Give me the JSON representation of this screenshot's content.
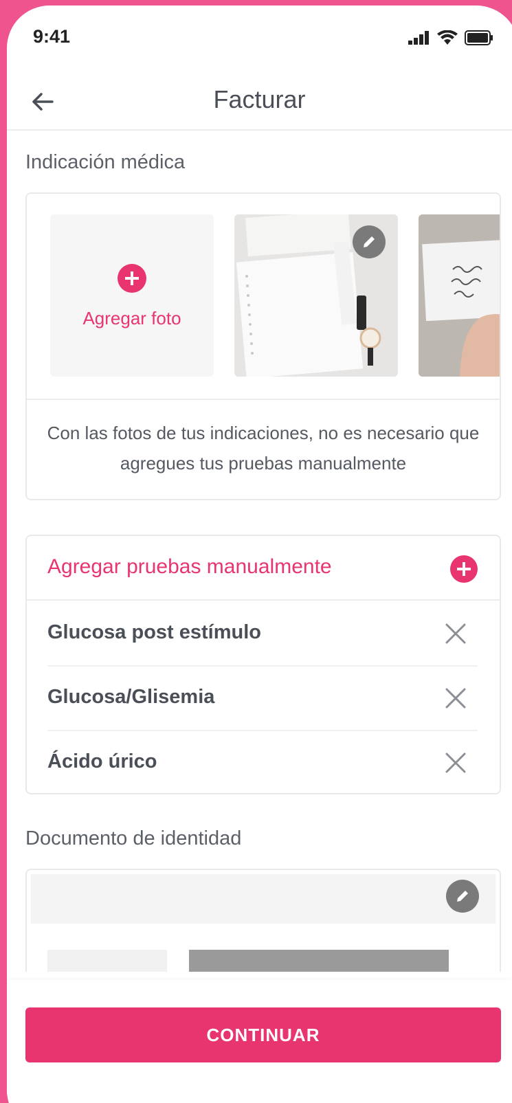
{
  "status_bar": {
    "time": "9:41",
    "icons": [
      "signal-icon",
      "wifi-icon",
      "battery-icon"
    ]
  },
  "header": {
    "back_icon": "arrow-left-icon",
    "title": "Facturar"
  },
  "medical_indication": {
    "label": "Indicación médica",
    "add_photo_label": "Agregar foto",
    "hint": "Con las fotos de tus indicaciones, no es necesario que agregues tus pruebas manualmente"
  },
  "manual_tests": {
    "header_label": "Agregar pruebas manualmente",
    "items": [
      {
        "label": "Glucosa post estímulo"
      },
      {
        "label": "Glucosa/Glisemia"
      },
      {
        "label": "Ácido úrico"
      }
    ]
  },
  "identity_document": {
    "label": "Documento de identidad"
  },
  "footer": {
    "continue_label": "CONTINUAR"
  },
  "colors": {
    "accent": "#e8346f",
    "background_frame": "#f0548f",
    "text": "#4a4f57"
  }
}
